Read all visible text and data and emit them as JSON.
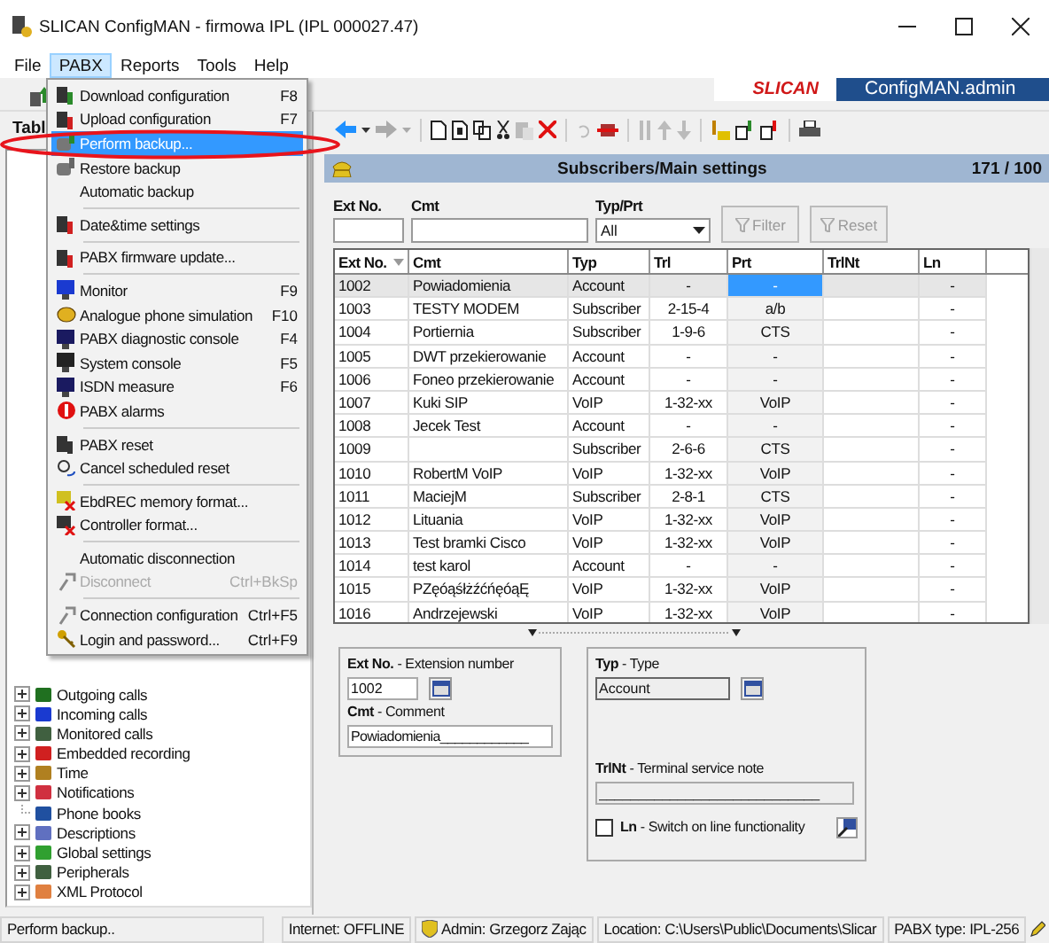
{
  "window": {
    "title": "SLICAN ConfigMAN - firmowa IPL (IPL 000027.47)"
  },
  "menu_bar": [
    {
      "label": "File",
      "selected": false
    },
    {
      "label": "PABX",
      "selected": true
    },
    {
      "label": "Reports",
      "selected": false
    },
    {
      "label": "Tools",
      "selected": false
    },
    {
      "label": "Help",
      "selected": false
    }
  ],
  "pabx_menu": [
    {
      "kind": "item",
      "label": "Download configuration",
      "shortcut": "F8",
      "selected": false,
      "disabled": false
    },
    {
      "kind": "item",
      "label": "Upload configuration",
      "shortcut": "F7",
      "selected": false,
      "disabled": false
    },
    {
      "kind": "item",
      "label": "Perform backup...",
      "selected": true,
      "disabled": false
    },
    {
      "kind": "item",
      "label": "Restore backup",
      "selected": false,
      "disabled": false
    },
    {
      "kind": "item",
      "label": "Automatic backup",
      "selected": false,
      "disabled": false
    },
    {
      "kind": "separator"
    },
    {
      "kind": "item",
      "label": "Date&time settings",
      "selected": false,
      "disabled": false
    },
    {
      "kind": "separator"
    },
    {
      "kind": "item",
      "label": "PABX firmware update...",
      "selected": false,
      "disabled": false
    },
    {
      "kind": "separator"
    },
    {
      "kind": "item",
      "label": "Monitor",
      "shortcut": "F9",
      "selected": false,
      "disabled": false
    },
    {
      "kind": "item",
      "label": "Analogue phone simulation",
      "shortcut": "F10",
      "selected": false,
      "disabled": false
    },
    {
      "kind": "item",
      "label": "PABX diagnostic console",
      "shortcut": "F4",
      "selected": false,
      "disabled": false
    },
    {
      "kind": "item",
      "label": "System console",
      "shortcut": "F5",
      "selected": false,
      "disabled": false
    },
    {
      "kind": "item",
      "label": "ISDN measure",
      "shortcut": "F6",
      "selected": false,
      "disabled": false
    },
    {
      "kind": "item",
      "label": "PABX alarms",
      "selected": false,
      "disabled": false
    },
    {
      "kind": "separator"
    },
    {
      "kind": "item",
      "label": "PABX reset",
      "selected": false,
      "disabled": false
    },
    {
      "kind": "item",
      "label": "Cancel scheduled reset",
      "selected": false,
      "disabled": false
    },
    {
      "kind": "separator"
    },
    {
      "kind": "item",
      "label": "EbdREC memory format...",
      "selected": false,
      "disabled": false
    },
    {
      "kind": "item",
      "label": "Controller format...",
      "selected": false,
      "disabled": false
    },
    {
      "kind": "separator"
    },
    {
      "kind": "item",
      "label": "Automatic disconnection",
      "selected": false,
      "disabled": false
    },
    {
      "kind": "item",
      "label": "Disconnect",
      "shortcut": "Ctrl+BkSp",
      "selected": false,
      "disabled": true
    },
    {
      "kind": "separator"
    },
    {
      "kind": "item",
      "label": "Connection configuration",
      "shortcut": "Ctrl+F5",
      "selected": false,
      "disabled": false
    },
    {
      "kind": "item",
      "label": "Login and password...",
      "shortcut": "Ctrl+F9",
      "selected": false,
      "disabled": false
    }
  ],
  "annotation": {
    "kind": "ellipse"
  },
  "logo": {
    "brand": "SLICAN",
    "product": "ConfigMAN.admin"
  },
  "left_panel": {
    "tab": "Tabl",
    "tree": [
      {
        "label": "Outgoing calls",
        "expandable": true
      },
      {
        "label": "Incoming calls",
        "expandable": true
      },
      {
        "label": "Monitored calls",
        "expandable": true
      },
      {
        "label": "Embedded recording",
        "expandable": true
      },
      {
        "label": "Time",
        "expandable": true
      },
      {
        "label": "Notifications",
        "expandable": true
      },
      {
        "label": "Phone books",
        "expandable": false
      },
      {
        "label": "Descriptions",
        "expandable": true
      },
      {
        "label": "Global settings",
        "expandable": true
      },
      {
        "label": "Peripherals",
        "expandable": true
      },
      {
        "label": "XML Protocol",
        "expandable": true
      }
    ]
  },
  "panel_header": {
    "title": "Subscribers/Main settings",
    "count": "171 / 100"
  },
  "filter": {
    "fields": [
      {
        "label": "Ext No."
      },
      {
        "label": "Cmt"
      }
    ],
    "select": {
      "label": "Typ/Prt",
      "value": "All"
    },
    "buttons": [
      {
        "label": "Filter",
        "disabled": true
      },
      {
        "label": "Reset",
        "disabled": true
      }
    ]
  },
  "table": {
    "columns": [
      {
        "label": "Ext No.",
        "sorted": true,
        "selected": false
      },
      {
        "label": "Cmt",
        "sorted": false,
        "selected": false
      },
      {
        "label": "Typ",
        "sorted": false,
        "selected": false
      },
      {
        "label": "Trl",
        "sorted": false,
        "selected": false
      },
      {
        "label": "Prt",
        "sorted": false,
        "selected": true
      },
      {
        "label": "TrlNt",
        "sorted": false,
        "selected": false
      },
      {
        "label": "Ln",
        "sorted": false,
        "selected": false
      }
    ],
    "rows": [
      {
        "cells": [
          "1002",
          "Powiadomienia",
          "Account",
          "-",
          "-",
          "",
          "-"
        ],
        "selected": true
      },
      {
        "cells": [
          "1003",
          "TESTY MODEM",
          "Subscriber",
          "2-15-4",
          "a/b",
          "",
          "-"
        ],
        "selected": false
      },
      {
        "cells": [
          "1004",
          "Portiernia",
          "Subscriber",
          "1-9-6",
          "CTS",
          "",
          "-"
        ],
        "selected": false
      },
      {
        "cells": [
          "1005",
          "DWT przekierowanie",
          "Account",
          "-",
          "-",
          "",
          "-"
        ],
        "selected": false
      },
      {
        "cells": [
          "1006",
          "Foneo przekierowanie",
          "Account",
          "-",
          "-",
          "",
          "-"
        ],
        "selected": false
      },
      {
        "cells": [
          "1007",
          "Kuki SIP",
          "VoIP",
          "1-32-xx",
          "VoIP",
          "",
          "-"
        ],
        "selected": false
      },
      {
        "cells": [
          "1008",
          "Jecek Test",
          "Account",
          "-",
          "-",
          "",
          "-"
        ],
        "selected": false
      },
      {
        "cells": [
          "1009",
          "",
          "Subscriber",
          "2-6-6",
          "CTS",
          "",
          "-"
        ],
        "selected": false
      },
      {
        "cells": [
          "1010",
          "RobertM VoIP",
          "VoIP",
          "1-32-xx",
          "VoIP",
          "",
          "-"
        ],
        "selected": false
      },
      {
        "cells": [
          "1011",
          "MaciejM",
          "Subscriber",
          "2-8-1",
          "CTS",
          "",
          "-"
        ],
        "selected": false
      },
      {
        "cells": [
          "1012",
          "Lituania",
          "VoIP",
          "1-32-xx",
          "VoIP",
          "",
          "-"
        ],
        "selected": false
      },
      {
        "cells": [
          "1013",
          "Test bramki Cisco",
          "VoIP",
          "1-32-xx",
          "VoIP",
          "",
          "-"
        ],
        "selected": false
      },
      {
        "cells": [
          "1014",
          "test karol",
          "Account",
          "-",
          "-",
          "",
          "-"
        ],
        "selected": false
      },
      {
        "cells": [
          "1015",
          "PZęóąśłżźćńęóąĘ",
          "VoIP",
          "1-32-xx",
          "VoIP",
          "",
          "-"
        ],
        "selected": false
      },
      {
        "cells": [
          "1016",
          "Andrzejewski",
          "VoIP",
          "1-32-xx",
          "VoIP",
          "",
          "-"
        ],
        "selected": false
      }
    ]
  },
  "details": {
    "ext": {
      "label": "**Ext No.** - Extension number",
      "value": "1002"
    },
    "cmt": {
      "label": "**Cmt** - Comment",
      "value": "Powiadomienia____________"
    },
    "typ": {
      "label": "**Typ** - Type",
      "value": "Account"
    },
    "trlnt": {
      "label": "**TrlNt** - Terminal service note",
      "value": "____________________________",
      "disabled": true
    },
    "ln": {
      "label": "**Ln** -  Switch on line functionality",
      "checked": false
    }
  },
  "status_bar": [
    {
      "kind": "text",
      "text": "Perform backup.."
    },
    {
      "kind": "text",
      "text": "Internet: OFFLINE"
    },
    {
      "kind": "user",
      "text": "Admin: Grzegorz Zając"
    },
    {
      "kind": "text",
      "text": "Location: C:\\Users\\Public\\Documents\\Slicar"
    },
    {
      "kind": "text",
      "text": "PABX type: IPL-256"
    }
  ]
}
